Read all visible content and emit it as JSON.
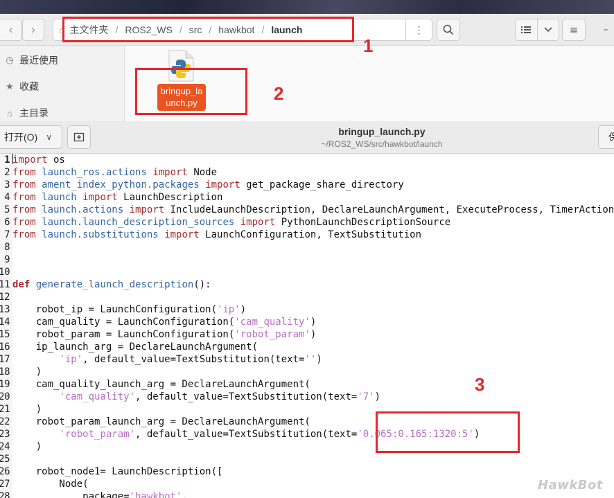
{
  "file_manager": {
    "path": [
      "主文件夹",
      "ROS2_WS",
      "src",
      "hawkbot",
      "launch"
    ],
    "sidebar": [
      {
        "label": "最近使用",
        "icon": "clock-icon"
      },
      {
        "label": "收藏",
        "icon": "star-icon"
      },
      {
        "label": "主目录",
        "icon": "home-icon"
      }
    ],
    "file": {
      "label": "bringup_launch.py",
      "icon": "python-file-icon"
    }
  },
  "editor": {
    "open_label": "打开(O)",
    "title": "bringup_launch.py",
    "subtitle": "~/ROS2_WS/src/hawkbot/launch",
    "save_label": "保",
    "lines": [
      [
        [
          "kw",
          "import"
        ],
        [
          "t",
          " os"
        ]
      ],
      [
        [
          "kw",
          "from"
        ],
        [
          "t",
          " "
        ],
        [
          "mod",
          "launch_ros.actions"
        ],
        [
          "t",
          " "
        ],
        [
          "kw",
          "import"
        ],
        [
          "t",
          " Node"
        ]
      ],
      [
        [
          "kw",
          "from"
        ],
        [
          "t",
          " "
        ],
        [
          "mod",
          "ament_index_python.packages"
        ],
        [
          "t",
          " "
        ],
        [
          "kw",
          "import"
        ],
        [
          "t",
          " get_package_share_directory"
        ]
      ],
      [
        [
          "kw",
          "from"
        ],
        [
          "t",
          " "
        ],
        [
          "mod",
          "launch"
        ],
        [
          "t",
          " "
        ],
        [
          "kw",
          "import"
        ],
        [
          "t",
          " LaunchDescription"
        ]
      ],
      [
        [
          "kw",
          "from"
        ],
        [
          "t",
          " "
        ],
        [
          "mod",
          "launch.actions"
        ],
        [
          "t",
          " "
        ],
        [
          "kw",
          "import"
        ],
        [
          "t",
          " IncludeLaunchDescription, DeclareLaunchArgument, ExecuteProcess, TimerAction"
        ]
      ],
      [
        [
          "kw",
          "from"
        ],
        [
          "t",
          " "
        ],
        [
          "mod",
          "launch.launch_description_sources"
        ],
        [
          "t",
          " "
        ],
        [
          "kw",
          "import"
        ],
        [
          "t",
          " PythonLaunchDescriptionSource"
        ]
      ],
      [
        [
          "kw",
          "from"
        ],
        [
          "t",
          " "
        ],
        [
          "mod",
          "launch.substitutions"
        ],
        [
          "t",
          " "
        ],
        [
          "kw",
          "import"
        ],
        [
          "t",
          " LaunchConfiguration, TextSubstitution"
        ]
      ],
      [],
      [],
      [],
      [
        [
          "def",
          "def"
        ],
        [
          "t",
          " "
        ],
        [
          "fn",
          "generate_launch_description"
        ],
        [
          "t",
          "():"
        ]
      ],
      [],
      [
        [
          "t",
          "    robot_ip = LaunchConfiguration("
        ],
        [
          "str",
          "'ip'"
        ],
        [
          "t",
          ")"
        ]
      ],
      [
        [
          "t",
          "    cam_quality = LaunchConfiguration("
        ],
        [
          "str",
          "'cam_quality'"
        ],
        [
          "t",
          ")"
        ]
      ],
      [
        [
          "t",
          "    robot_param = LaunchConfiguration("
        ],
        [
          "str",
          "'robot_param'"
        ],
        [
          "t",
          ")"
        ]
      ],
      [
        [
          "t",
          "    ip_launch_arg = DeclareLaunchArgument("
        ]
      ],
      [
        [
          "t",
          "        "
        ],
        [
          "str",
          "'ip'"
        ],
        [
          "t",
          ", default_value=TextSubstitution(text="
        ],
        [
          "str",
          "''"
        ],
        [
          "t",
          ")"
        ]
      ],
      [
        [
          "t",
          "    )"
        ]
      ],
      [
        [
          "t",
          "    cam_quality_launch_arg = DeclareLaunchArgument("
        ]
      ],
      [
        [
          "t",
          "        "
        ],
        [
          "str",
          "'cam_quality'"
        ],
        [
          "t",
          ", default_value=TextSubstitution(text="
        ],
        [
          "str",
          "'7'"
        ],
        [
          "t",
          ")"
        ]
      ],
      [
        [
          "t",
          "    )"
        ]
      ],
      [
        [
          "t",
          "    robot_param_launch_arg = DeclareLaunchArgument("
        ]
      ],
      [
        [
          "t",
          "        "
        ],
        [
          "str",
          "'robot_param'"
        ],
        [
          "t",
          ", default_value=TextSubstitution(text="
        ],
        [
          "str",
          "'0.065:0.165:1320:5'"
        ],
        [
          "t",
          ")"
        ]
      ],
      [
        [
          "t",
          "    )"
        ]
      ],
      [],
      [
        [
          "t",
          "    robot_node1= LaunchDescription(["
        ]
      ],
      [
        [
          "t",
          "        Node("
        ]
      ],
      [
        [
          "t",
          "            package="
        ],
        [
          "str",
          "'hawkbot'"
        ],
        [
          "t",
          ","
        ]
      ]
    ]
  },
  "annotations": {
    "n1": "1",
    "n2": "2",
    "n3": "3"
  },
  "watermark": "HawkBot",
  "colors": {
    "accent": "#e95420",
    "annotation": "#e8262a",
    "keyword": "#a52a2a",
    "module": "#3465a4",
    "string": "#b86fc4"
  }
}
